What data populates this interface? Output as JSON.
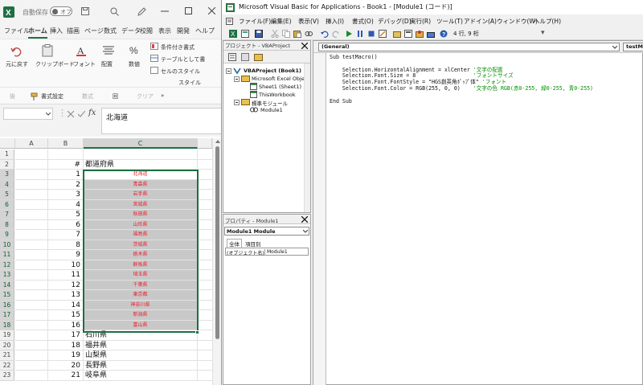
{
  "excel": {
    "autosave_label": "自動保存",
    "autosave_state": "オフ",
    "tabs": [
      "ファイル",
      "ホーム",
      "挿入",
      "描画",
      "ページ",
      "数式",
      "データ",
      "校閲",
      "表示",
      "開発",
      "ヘルプ"
    ],
    "active_tab": "ホーム",
    "ribbon": {
      "undo_label": "元に戻す",
      "clipboard_label": "クリップボード",
      "font_label": "フォント",
      "alignment_label": "配置",
      "number_label": "数値",
      "cond_format_label": "条件付き書式",
      "table_format_label": "テーブルとして書",
      "cell_style_label": "セルのスタイル",
      "style_group_label": "スタイル"
    },
    "quick_access": {
      "item1": "後",
      "format_painter": "書式設定",
      "item3": "数式",
      "item4": "回",
      "clear_label": "クリア",
      "more": "»"
    },
    "formula_bar": {
      "fx": "fx",
      "value": "北海道"
    },
    "columns": [
      "A",
      "B",
      "C"
    ],
    "header_row": {
      "row": "2",
      "b": "#",
      "c": "都道府県"
    },
    "rows": [
      {
        "row": "1",
        "b": "",
        "c": ""
      },
      {
        "row": "2",
        "b": "#",
        "c": "都道府県"
      },
      {
        "row": "3",
        "b": "1",
        "c": "北海道"
      },
      {
        "row": "4",
        "b": "2",
        "c": "青森県"
      },
      {
        "row": "5",
        "b": "3",
        "c": "岩手県"
      },
      {
        "row": "6",
        "b": "4",
        "c": "宮城県"
      },
      {
        "row": "7",
        "b": "5",
        "c": "秋田県"
      },
      {
        "row": "8",
        "b": "6",
        "c": "山形県"
      },
      {
        "row": "9",
        "b": "7",
        "c": "福島県"
      },
      {
        "row": "10",
        "b": "8",
        "c": "茨城県"
      },
      {
        "row": "11",
        "b": "9",
        "c": "栃木県"
      },
      {
        "row": "12",
        "b": "10",
        "c": "群馬県"
      },
      {
        "row": "13",
        "b": "11",
        "c": "埼玉県"
      },
      {
        "row": "14",
        "b": "12",
        "c": "千葉県"
      },
      {
        "row": "15",
        "b": "13",
        "c": "東京都"
      },
      {
        "row": "16",
        "b": "14",
        "c": "神奈川県"
      },
      {
        "row": "17",
        "b": "15",
        "c": "新潟県"
      },
      {
        "row": "18",
        "b": "16",
        "c": "富山県"
      },
      {
        "row": "19",
        "b": "17",
        "c": "石川県"
      },
      {
        "row": "20",
        "b": "18",
        "c": "福井県"
      },
      {
        "row": "21",
        "b": "19",
        "c": "山梨県"
      },
      {
        "row": "22",
        "b": "20",
        "c": "長野県"
      },
      {
        "row": "23",
        "b": "21",
        "c": "岐阜県"
      }
    ]
  },
  "vba": {
    "title": "Microsoft Visual Basic for Applications - Book1 - [Module1 (コード)]",
    "menu": [
      "ファイル(F)",
      "編集(E)",
      "表示(V)",
      "挿入(I)",
      "書式(O)",
      "デバッグ(D)",
      "実行(R)",
      "ツール(T)",
      "アドイン(A)",
      "ウィンドウ(W)",
      "ヘルプ(H)"
    ],
    "toolbar_position": "4 行, 9 桁",
    "project_title": "プロジェクト - VBAProject",
    "tree": {
      "root": "VBAProject (Book1)",
      "excel_objects": "Microsoft Excel Objec",
      "sheet1": "Sheet1 (Sheet1)",
      "thisworkbook": "ThisWorkbook",
      "modules": "標準モジュール",
      "module1": "Module1"
    },
    "properties": {
      "title": "プロパティ - Module1",
      "combo": "Module1 Module",
      "tab_all": "全体",
      "tab_category": "項目別",
      "prop_name": "(オブジェクト名)",
      "prop_value": "Module1"
    },
    "code_combo_left": "(General)",
    "code_combo_right": "testM",
    "code_lines": [
      {
        "code": "Sub testMacro()",
        "comment": ""
      },
      {
        "code": "",
        "comment": ""
      },
      {
        "code": "    Selection.HorizontalAlignment = xlCenter ",
        "comment": "'文字の配置"
      },
      {
        "code": "    Selection.Font.Size = 8                  ",
        "comment": "'フォントサイズ"
      },
      {
        "code": "    Selection.Font.FontStyle = \"HGS創英角ﾎﾟｯﾌﾟ体\" ",
        "comment": "'フォント"
      },
      {
        "code": "    Selection.Font.Color = RGB(255, 0, 0)    ",
        "comment": "'文字の色 RGB(赤0-255, 緑0-255, 青0-255)"
      },
      {
        "code": "",
        "comment": ""
      },
      {
        "code": "End Sub",
        "comment": ""
      }
    ]
  },
  "colors": {
    "excel_green": "#1d7044",
    "selection_fill": "#c8c8c8",
    "red_text": "#e8202a",
    "comment_green": "#009000"
  }
}
